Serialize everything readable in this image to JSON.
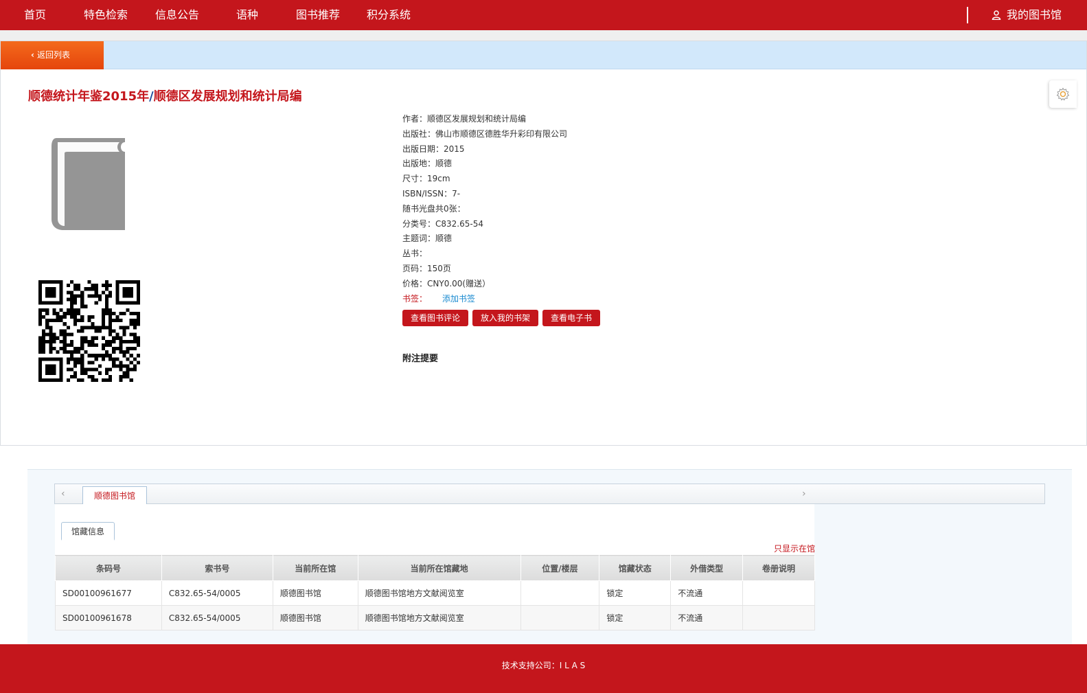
{
  "nav": {
    "items": [
      "首页",
      "特色检索",
      "信息公告",
      "语种",
      "图书推荐",
      "积分系统"
    ],
    "my_library": "我的图书馆"
  },
  "back_button": "返回列表",
  "book": {
    "title_main": "顺德统计年鉴2015年",
    "title_sep": "/",
    "title_resp": "顺德区发展规划和统计局编"
  },
  "info": {
    "author_label": "作者：",
    "author": "顺德区发展规划和统计局编",
    "publisher_label": "出版社：",
    "publisher": "佛山市顺德区德胜华升彩印有限公司",
    "pubdate_label": "出版日期：",
    "pubdate": "2015",
    "place_label": "出版地：",
    "place": "顺德",
    "size_label": "尺寸：",
    "size": "19cm",
    "isbn_label": "ISBN/ISSN：",
    "isbn": "7-",
    "disc_label": "随书光盘共0张：",
    "class_label": "分类号：",
    "class": "C832.65-54",
    "subject_label": "主题词：",
    "subject": "顺德",
    "series_label": "丛书：",
    "pages_label": "页码：",
    "pages": "150页",
    "price_label": "价格：",
    "price": "CNY0.00(赠送）",
    "bookmark_label": "书签：",
    "bookmark_add": "添加书签"
  },
  "buttons": {
    "review": "查看图书评论",
    "shelf": "放入我的书架",
    "ebook": "查看电子书"
  },
  "remark_title": "附注提要",
  "holdings": {
    "library_tab": "顺德图书馆",
    "sub_tab": "馆藏信息",
    "only_in": "只显示在馆",
    "columns": [
      "条码号",
      "索书号",
      "当前所在馆",
      "当前所在馆藏地",
      "位置/楼层",
      "馆藏状态",
      "外借类型",
      "卷册说明"
    ],
    "rows": [
      [
        "SD00100961677",
        "C832.65-54/0005",
        "顺德图书馆",
        "顺德图书馆地方文献阅览室",
        "",
        "锁定",
        "不流通",
        ""
      ],
      [
        "SD00100961678",
        "C832.65-54/0005",
        "顺德图书馆",
        "顺德图书馆地方文献阅览室",
        "",
        "锁定",
        "不流通",
        ""
      ]
    ]
  },
  "footer": "技术支持公司：I L A S",
  "colors": {
    "brand_red": "#c4161c",
    "back_orange": "#f46a1c",
    "info_blue": "#d2e8fb"
  }
}
